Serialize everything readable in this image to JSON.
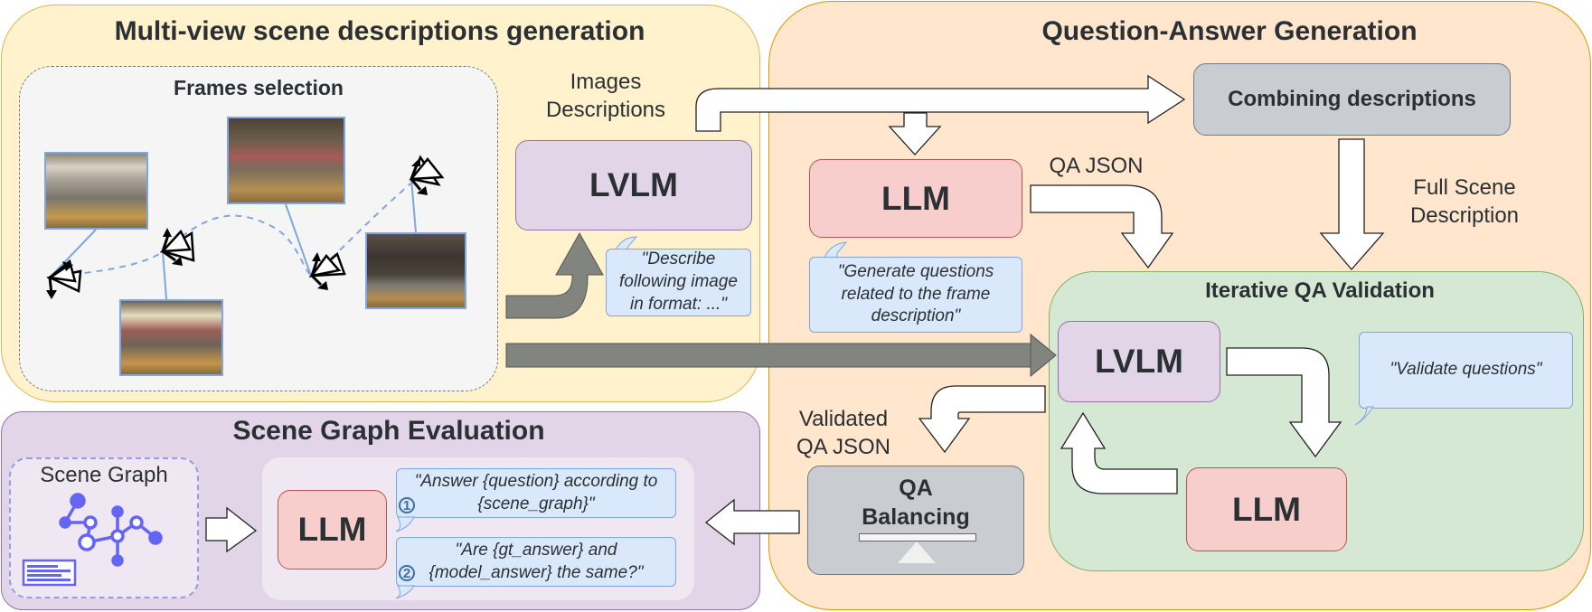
{
  "colors": {
    "multiview_fill": "#fff2cc",
    "multiview_border": "#d6b656",
    "qa_fill": "#ffe6cc",
    "qa_border": "#d79b00",
    "sge_fill": "#e1d5e7",
    "sge_border": "#9673a6",
    "validation_fill": "#d5e8d4",
    "validation_border": "#82b366",
    "lvlm_fill": "#e1d5e7",
    "llm_fill": "#f8cecc",
    "llm_border": "#b85450",
    "gray_box_fill": "#c9cdd1",
    "bubble_fill": "#dae8fc",
    "gray_arrow": "#82847f",
    "graph_icon": "#6464f5"
  },
  "multiview": {
    "title": "Multi-view scene descriptions generation",
    "frames_selection": {
      "title": "Frames selection",
      "frames": [
        "hallway-kitchen-frame",
        "living-room-frame",
        "kitchen-view-frame",
        "bedroom-frame"
      ],
      "cameras": [
        "camera-1",
        "camera-2",
        "camera-3",
        "camera-4"
      ]
    },
    "images_descriptions_label": "Images Descriptions",
    "lvlm_label": "LVLM",
    "lvlm_prompt": "\"Describe following image in format: ...\""
  },
  "qa_generation": {
    "title": "Question-Answer Generation",
    "combining_label": "Combining descriptions",
    "llm_label": "LLM",
    "qa_json_label": "QA JSON",
    "llm_prompt": "\"Generate questions related to the frame description\"",
    "full_scene_label": "Full Scene Description",
    "validated_label": "Validated QA JSON",
    "balancing_label": "QA Balancing",
    "iterative": {
      "title": "Iterative QA Validation",
      "lvlm_label": "LVLM",
      "llm_label": "LLM",
      "prompt": "\"Validate questions\""
    }
  },
  "scene_graph_eval": {
    "title": "Scene Graph Evaluation",
    "scene_graph_label": "Scene Graph",
    "llm_label": "LLM",
    "prompts": [
      {
        "number": "1",
        "text": "\"Answer {question} according to {scene_graph}\""
      },
      {
        "number": "2",
        "text": "\"Are {gt_answer} and {model_answer} the same?\""
      }
    ]
  }
}
